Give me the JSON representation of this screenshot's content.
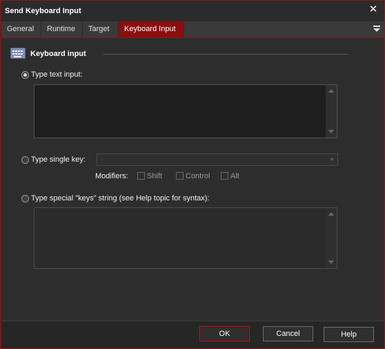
{
  "window": {
    "title": "Send Keyboard Input",
    "close_glyph": "✕"
  },
  "tabs": [
    {
      "label": "General"
    },
    {
      "label": "Runtime"
    },
    {
      "label": "Target"
    },
    {
      "label": "Keyboard Input",
      "active": true
    }
  ],
  "group": {
    "title": "Keyboard input",
    "icon": "keyboard-icon"
  },
  "options": {
    "type_text": {
      "label": "Type text input:",
      "selected": true,
      "value": ""
    },
    "single_key": {
      "label": "Type single key:",
      "selected": false,
      "value": ""
    },
    "modifiers": {
      "label": "Modifiers:",
      "shift": "Shift",
      "control": "Control",
      "alt": "Alt"
    },
    "special_keys": {
      "label": "Type special \"keys\" string (see Help topic for syntax):",
      "selected": false,
      "value": ""
    }
  },
  "buttons": {
    "ok": "OK",
    "cancel": "Cancel",
    "help": "Help"
  },
  "colors": {
    "accent": "#8b0d0d",
    "background": "#2d2d2d"
  }
}
